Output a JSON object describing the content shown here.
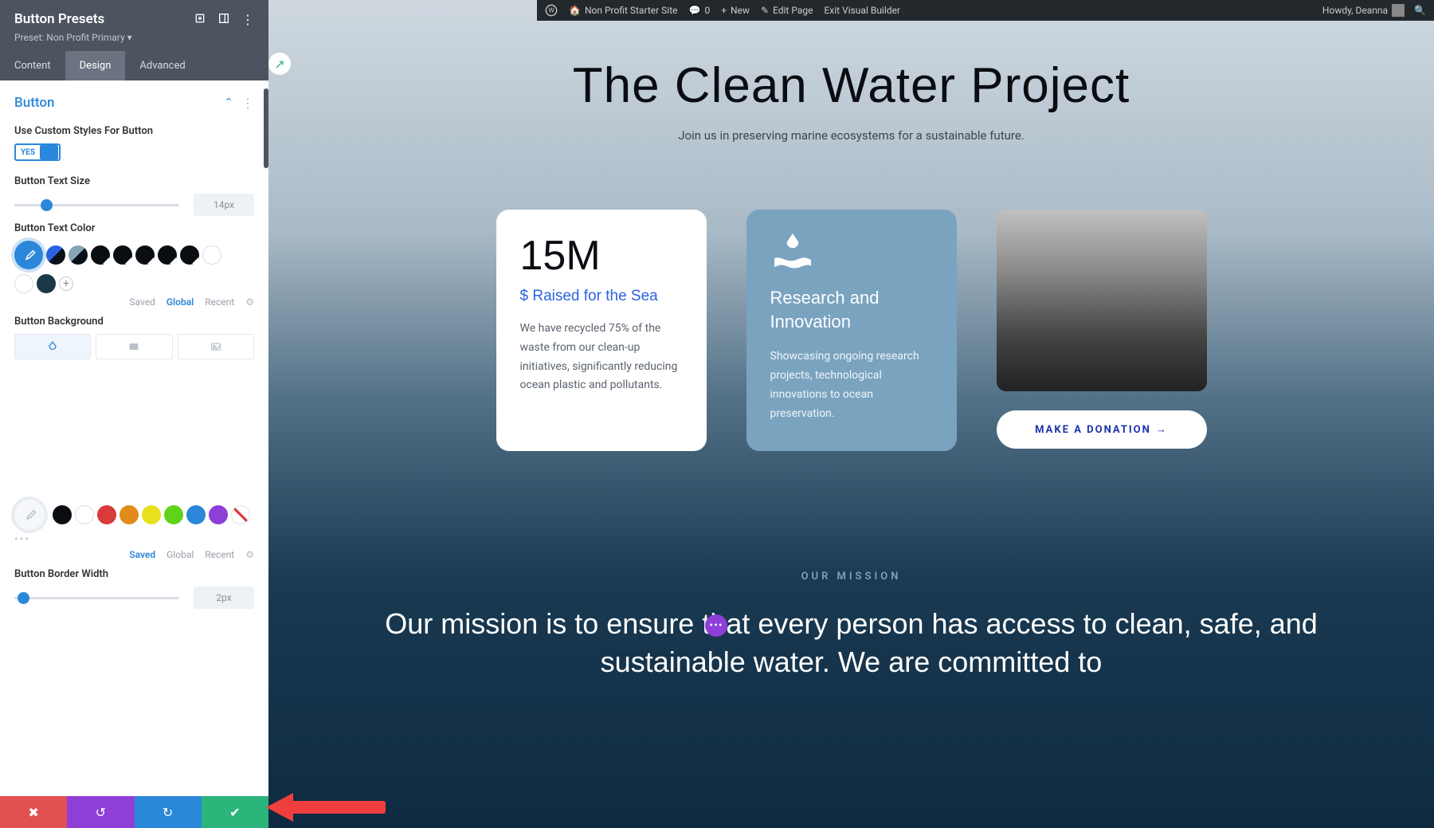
{
  "admin_bar": {
    "site": "Non Profit Starter Site",
    "comments": "0",
    "new": "New",
    "edit": "Edit Page",
    "exit": "Exit Visual Builder",
    "howdy": "Howdy, Deanna"
  },
  "panel": {
    "title": "Button Presets",
    "preset": "Preset: Non Profit Primary",
    "tabs": {
      "content": "Content",
      "design": "Design",
      "advanced": "Advanced"
    },
    "section": "Button",
    "use_custom": "Use Custom Styles For Button",
    "toggle": "YES",
    "text_size_label": "Button Text Size",
    "text_size_val": "14px",
    "text_color_label": "Button Text Color",
    "legend": {
      "saved": "Saved",
      "global": "Global",
      "recent": "Recent"
    },
    "bg_label": "Button Background",
    "border_label": "Button Border Width",
    "border_val": "2px"
  },
  "preview": {
    "title": "The Clean Water Project",
    "subtitle": "Join us in preserving marine ecosystems for a sustainable future.",
    "card1": {
      "stat": "15M",
      "sub": "$ Raised for the Sea",
      "desc": "We have recycled 75% of the waste from our clean-up initiatives, significantly reducing ocean plastic and pollutants."
    },
    "card2": {
      "head": "Research and Innovation",
      "desc": "Showcasing ongoing research projects, technological innovations to ocean preservation."
    },
    "cta": "MAKE A DONATION",
    "mission_label": "OUR MISSION",
    "mission": "Our mission is to ensure that every person has access to clean, safe, and sustainable water. We are committed to"
  },
  "colors": {
    "swatches2": [
      "#0a0d12",
      "#ffffff",
      "#d93a3a",
      "#e08b1a",
      "#e8e01a",
      "#5fd21a",
      "#2b87da",
      "#8d3fd8"
    ]
  }
}
